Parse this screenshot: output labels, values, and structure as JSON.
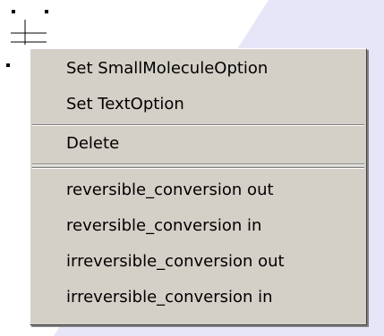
{
  "menu": {
    "items": [
      {
        "label": "Set SmallMoleculeOption"
      },
      {
        "label": "Set TextOption"
      },
      {
        "label": "Delete"
      },
      {
        "label": "reversible_conversion out"
      },
      {
        "label": "reversible_conversion in"
      },
      {
        "label": "irreversible_conversion out"
      },
      {
        "label": "irreversible_conversion in"
      }
    ]
  },
  "colors": {
    "menu_bg": "#d4d0c8",
    "band": "#dcdcf5",
    "text": "#000000"
  }
}
